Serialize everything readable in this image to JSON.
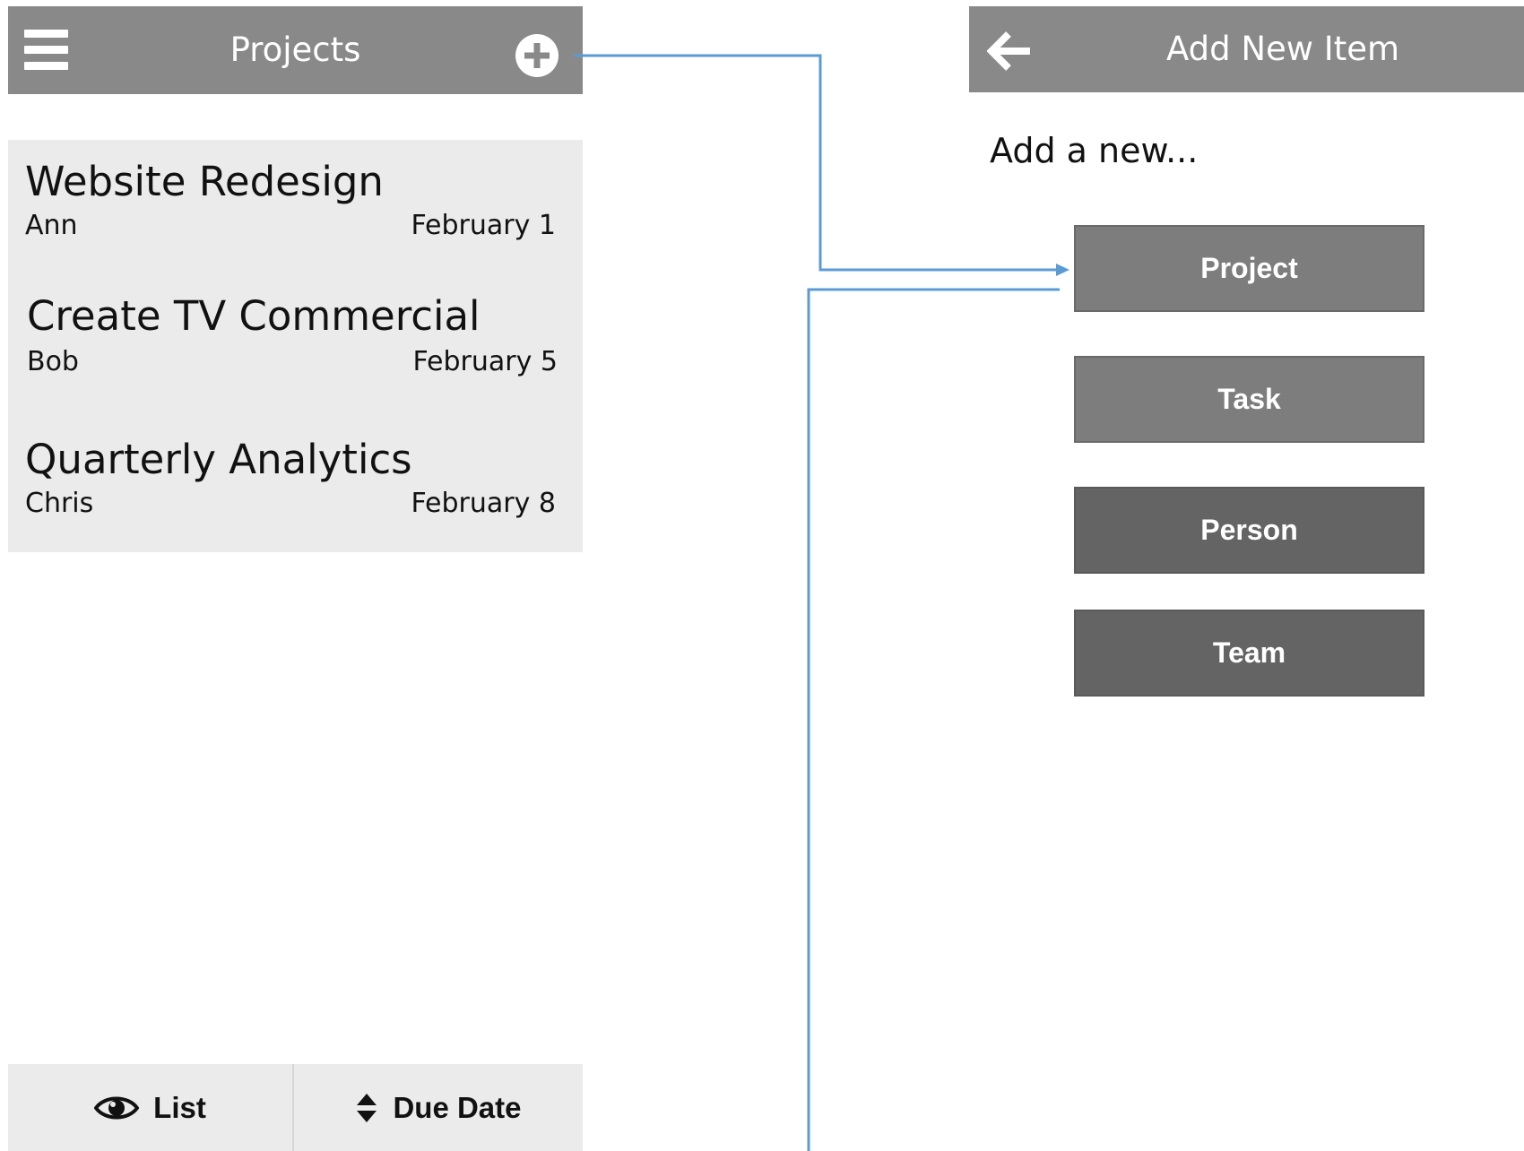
{
  "left_screen": {
    "header": {
      "title": "Projects",
      "menu_icon": "hamburger-menu-icon",
      "add_icon": "plus-circle-icon"
    },
    "projects": [
      {
        "title": "Website Redesign",
        "owner": "Ann",
        "due": "February 1"
      },
      {
        "title": "Create TV Commercial",
        "owner": "Bob",
        "due": "February 5"
      },
      {
        "title": "Quarterly Analytics",
        "owner": "Chris",
        "due": "February 8"
      }
    ],
    "bottom_bar": {
      "view_label": "List",
      "view_icon": "eye-icon",
      "sort_label": "Due Date",
      "sort_icon": "sort-arrows-icon"
    }
  },
  "right_screen": {
    "header": {
      "title": "Add New Item",
      "back_icon": "back-arrow-icon"
    },
    "prompt": "Add a new...",
    "options": [
      "Project",
      "Task",
      "Person",
      "Team"
    ]
  },
  "colors": {
    "header_bg": "#898989",
    "list_bg": "#ebebeb",
    "button_light": "#7d7d7d",
    "button_dark": "#646464",
    "connector": "#5b9bd5"
  }
}
